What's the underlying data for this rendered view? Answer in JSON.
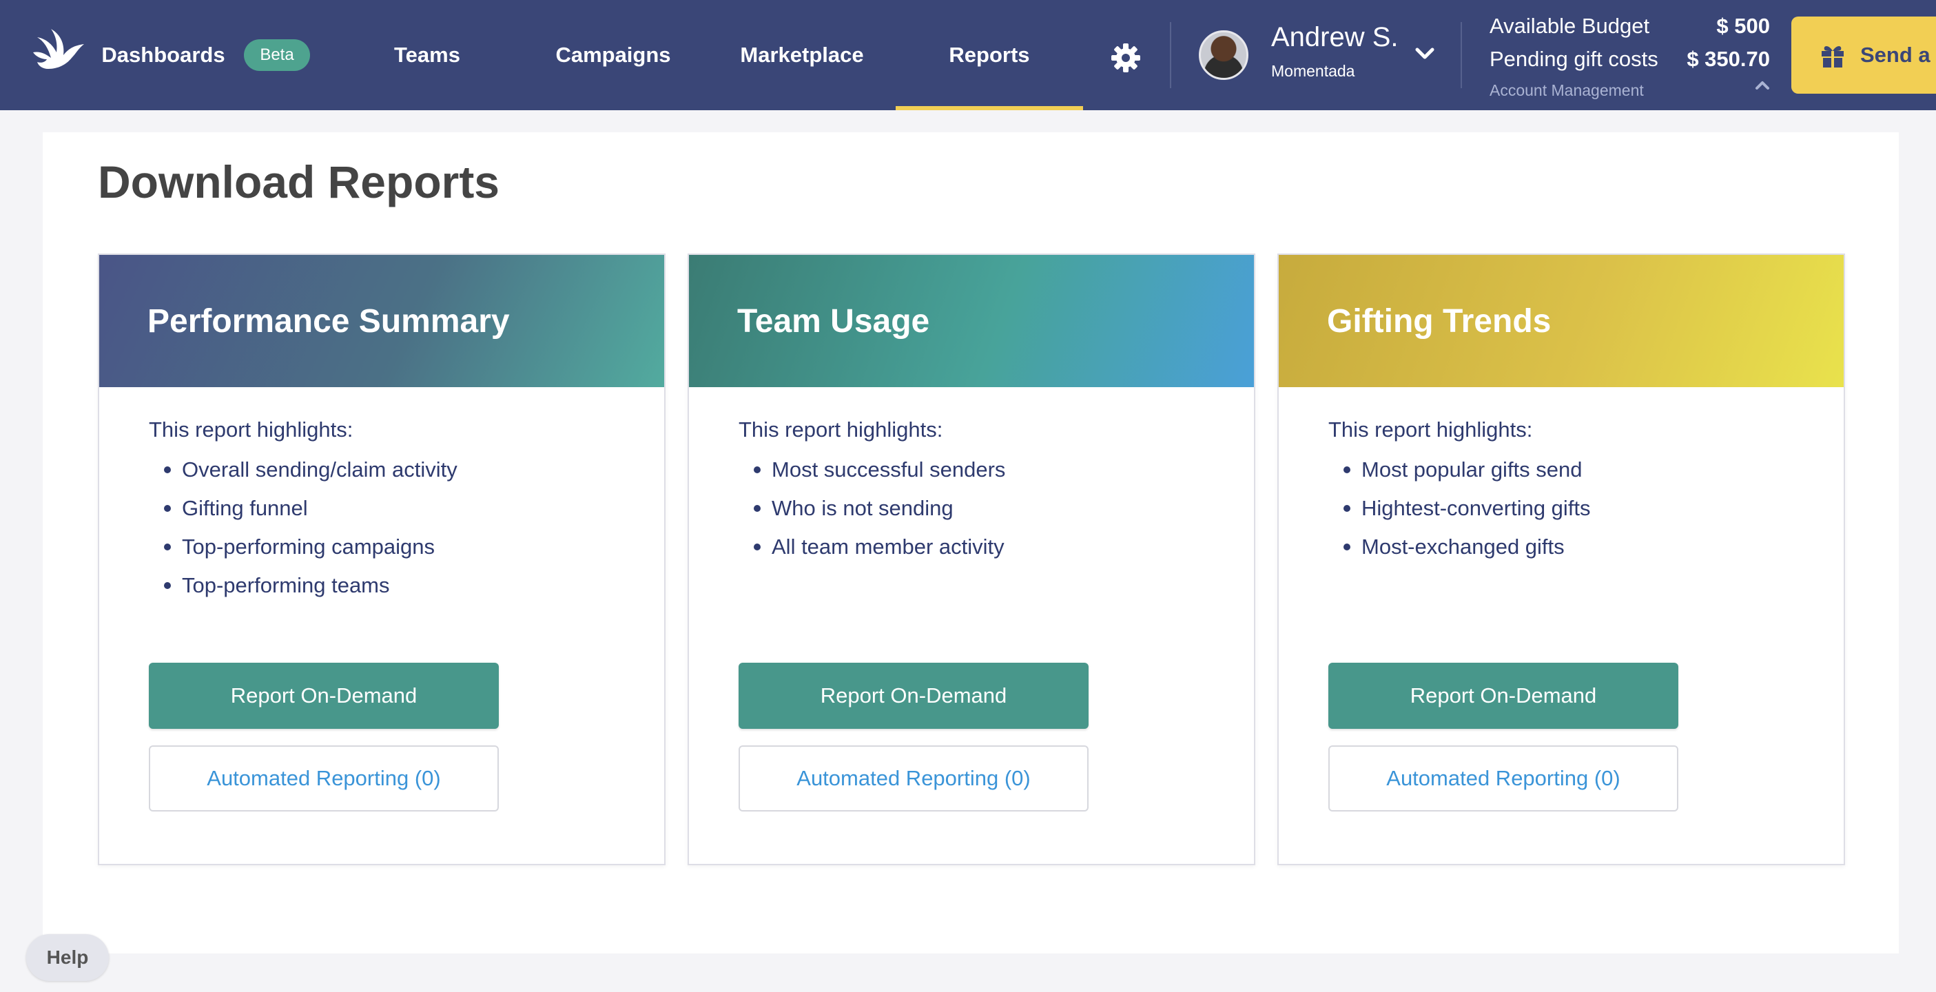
{
  "nav": {
    "logo_icon": "dove-logo-icon",
    "items": [
      {
        "label": "Dashboards",
        "active": false
      },
      {
        "label": "Teams",
        "active": false
      },
      {
        "label": "Campaigns",
        "active": false
      },
      {
        "label": "Marketplace",
        "active": false
      },
      {
        "label": "Reports",
        "active": true
      }
    ],
    "beta_label": "Beta",
    "settings_icon": "gear-icon",
    "active_underline_color": "#f2cf54"
  },
  "user": {
    "name": "Andrew S.",
    "company": "Momentada",
    "menu_icon": "chevron-down-icon"
  },
  "budget": {
    "available_label": "Available Budget",
    "available_value": "$ 500",
    "pending_label": "Pending gift costs",
    "pending_value": "$ 350.70",
    "account_link": "Account Management",
    "collapse_icon": "chevron-up-icon"
  },
  "send_button": {
    "label": "Send a g",
    "icon": "gift-icon"
  },
  "page": {
    "title": "Download Reports"
  },
  "cards": [
    {
      "title": "Performance Summary",
      "intro": "This report highlights:",
      "items": [
        "Overall sending/claim activity",
        "Gifting funnel",
        "Top-performing campaigns",
        "Top-performing teams"
      ],
      "primary_button": "Report On-Demand",
      "secondary_button": "Automated Reporting (0)"
    },
    {
      "title": "Team Usage",
      "intro": "This report highlights:",
      "items": [
        "Most successful senders",
        "Who is not sending",
        "All team member activity"
      ],
      "primary_button": "Report On-Demand",
      "secondary_button": "Automated Reporting (0)"
    },
    {
      "title": "Gifting Trends",
      "intro": "This report highlights:",
      "items": [
        "Most popular gifts send",
        "Hightest-converting gifts",
        "Most-exchanged gifts"
      ],
      "primary_button": "Report On-Demand",
      "secondary_button": "Automated Reporting (0)"
    }
  ],
  "help": {
    "label": "Help"
  },
  "colors": {
    "navbar": "#3a4677",
    "primary_button": "#48978b",
    "link": "#3a94d8",
    "send_button": "#f2cf54"
  }
}
